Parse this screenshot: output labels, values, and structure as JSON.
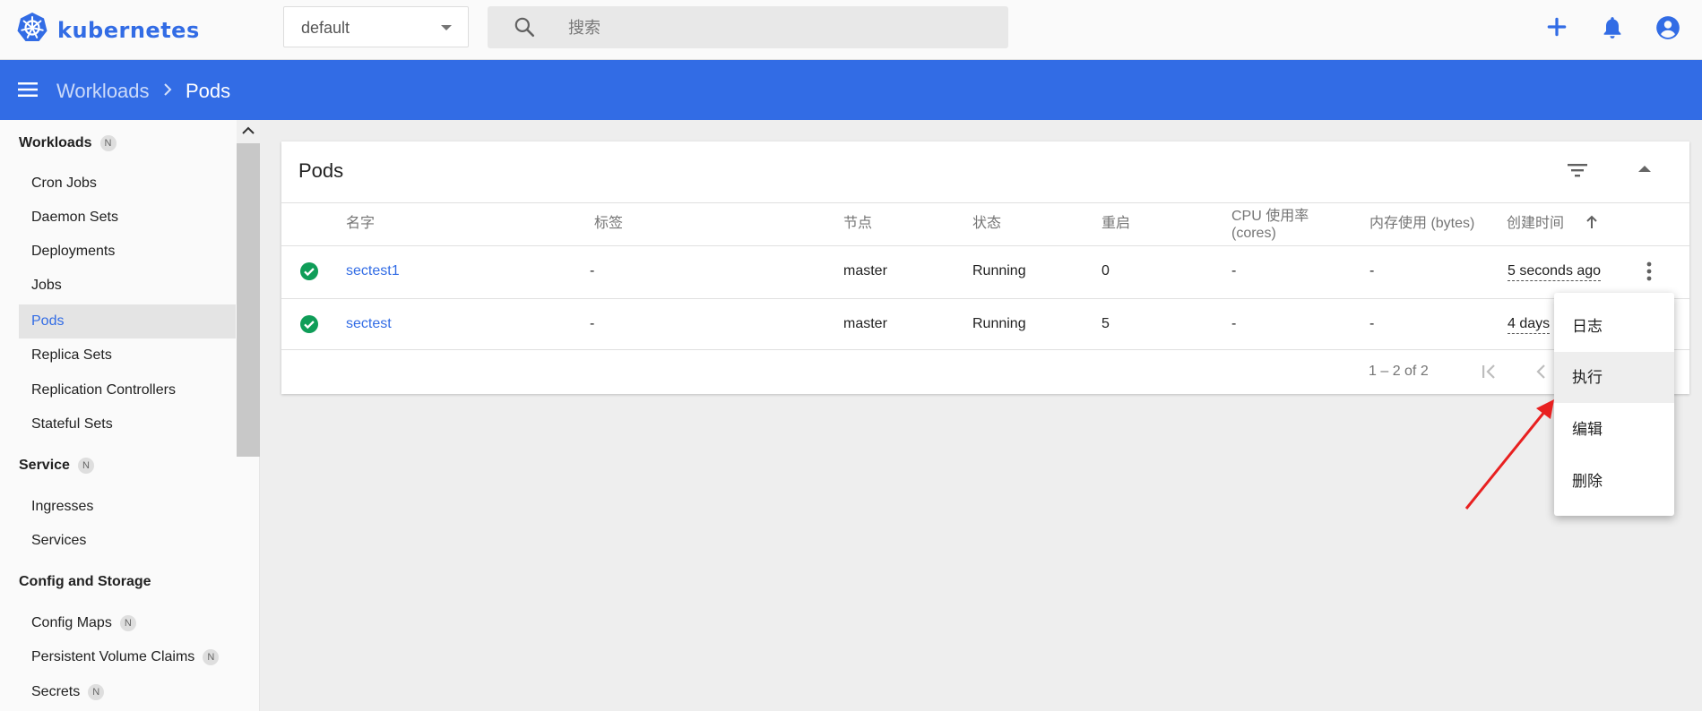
{
  "app": {
    "name": "kubernetes",
    "brand_color": "#326ce5"
  },
  "namespace": {
    "selected": "default"
  },
  "search": {
    "placeholder": "搜索"
  },
  "top_actions": [
    "add-icon",
    "bell-icon",
    "account-icon"
  ],
  "breadcrumb": {
    "parent": "Workloads",
    "current": "Pods"
  },
  "sidebar": {
    "badge_text": "N",
    "sections": [
      {
        "title": "Workloads",
        "badge": true,
        "items": [
          {
            "label": "Cron Jobs"
          },
          {
            "label": "Daemon Sets"
          },
          {
            "label": "Deployments"
          },
          {
            "label": "Jobs"
          },
          {
            "label": "Pods",
            "active": true
          },
          {
            "label": "Replica Sets"
          },
          {
            "label": "Replication Controllers"
          },
          {
            "label": "Stateful Sets"
          }
        ]
      },
      {
        "title": "Service",
        "badge": true,
        "items": [
          {
            "label": "Ingresses"
          },
          {
            "label": "Services"
          }
        ]
      },
      {
        "title": "Config and Storage",
        "badge": false,
        "items": [
          {
            "label": "Config Maps",
            "badge": true
          },
          {
            "label": "Persistent Volume Claims",
            "badge": true
          },
          {
            "label": "Secrets",
            "badge": true
          }
        ]
      }
    ]
  },
  "pods": {
    "title": "Pods",
    "columns": {
      "name": "名字",
      "labels": "标签",
      "node": "节点",
      "status": "状态",
      "restarts": "重启",
      "cpu_line1": "CPU 使用率",
      "cpu_line2": "(cores)",
      "memory": "内存使用 (bytes)",
      "created": "创建时间"
    },
    "rows": [
      {
        "name": "sectest1",
        "labels": "-",
        "node": "master",
        "status": "Running",
        "restarts": "0",
        "cpu": "-",
        "memory": "-",
        "created": "5 seconds ago"
      },
      {
        "name": "sectest",
        "labels": "-",
        "node": "master",
        "status": "Running",
        "restarts": "5",
        "cpu": "-",
        "memory": "-",
        "created": "4 days"
      }
    ],
    "pagination": "1 – 2 of 2"
  },
  "context_menu": {
    "items": [
      "日志",
      "执行",
      "编辑",
      "删除"
    ],
    "highlighted": "执行"
  },
  "status_ok_color": "#0f9d58"
}
